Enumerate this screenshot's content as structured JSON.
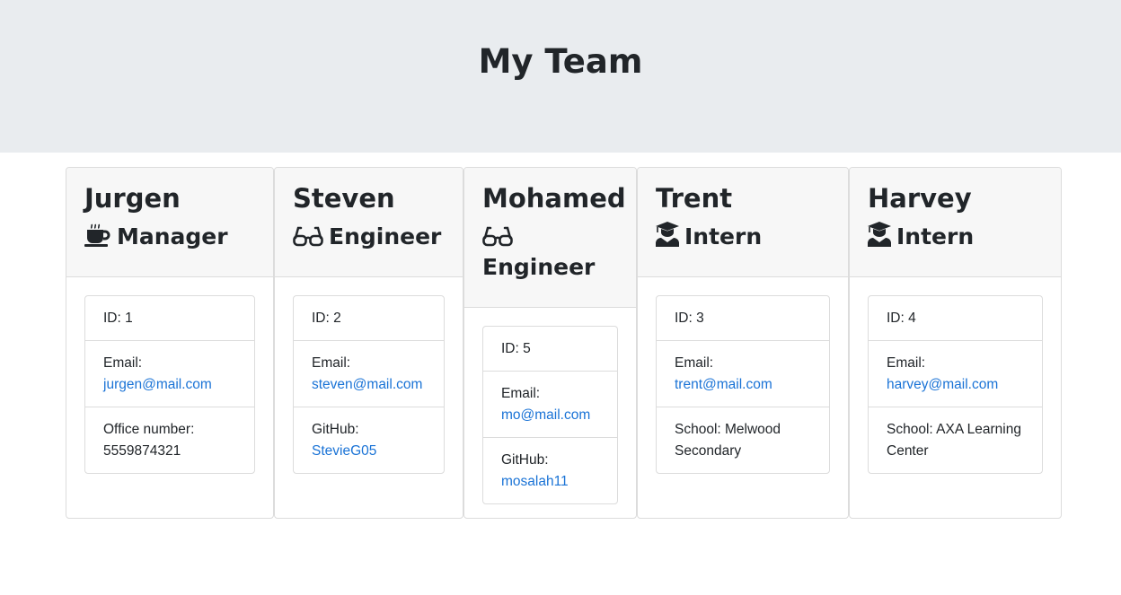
{
  "header": {
    "title": "My Team"
  },
  "team": [
    {
      "name": "Jurgen",
      "role": "Manager",
      "icon": "coffee-icon",
      "id_label": "ID: 1",
      "email_label": "Email:",
      "email": "jurgen@mail.com",
      "extra_label": "Office number:",
      "extra_value": "5559874321",
      "extra_is_link": false
    },
    {
      "name": "Steven",
      "role": "Engineer",
      "icon": "glasses-icon",
      "id_label": "ID: 2",
      "email_label": "Email:",
      "email": "steven@mail.com",
      "extra_label": "GitHub:",
      "extra_value": "StevieG05",
      "extra_is_link": true
    },
    {
      "name": "Mohamed",
      "role": "Engineer",
      "icon": "glasses-icon",
      "id_label": "ID: 5",
      "email_label": "Email:",
      "email": "mo@mail.com",
      "extra_label": "GitHub:",
      "extra_value": "mosalah11",
      "extra_is_link": true
    },
    {
      "name": "Trent",
      "role": "Intern",
      "icon": "graduate-icon",
      "id_label": "ID: 3",
      "email_label": "Email:",
      "email": "trent@mail.com",
      "extra_label": "School:",
      "extra_value": "Melwood Secondary",
      "extra_is_link": false
    },
    {
      "name": "Harvey",
      "role": "Intern",
      "icon": "graduate-icon",
      "id_label": "ID: 4",
      "email_label": "Email:",
      "email": "harvey@mail.com",
      "extra_label": "School:",
      "extra_value": "AXA Learning Center",
      "extra_is_link": false
    }
  ],
  "colors": {
    "header_bg": "#e9ecef",
    "link": "#1a73d6",
    "card_header_bg": "#f7f7f7",
    "border": "#dcdcdc"
  }
}
